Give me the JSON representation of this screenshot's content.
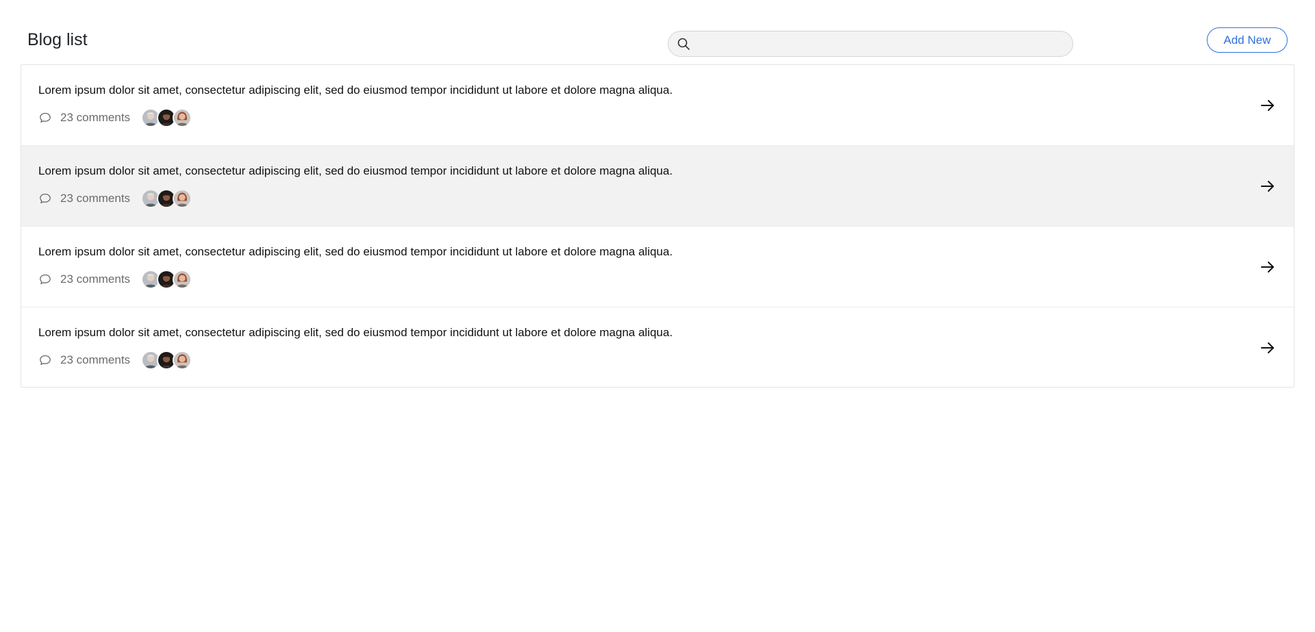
{
  "header": {
    "title": "Blog list",
    "search_placeholder": "",
    "search_value": "",
    "add_new_label": "Add New"
  },
  "colors": {
    "accent": "#2f6fdc",
    "row_highlight": "#f2f2f2",
    "border": "#e3e3e3"
  },
  "posts": [
    {
      "title": "Lorem ipsum dolor sit amet, consectetur adipiscing elit, sed do eiusmod tempor incididunt ut labore et dolore magna aliqua.",
      "comments": "23 comments",
      "highlighted": false
    },
    {
      "title": "Lorem ipsum dolor sit amet, consectetur adipiscing elit, sed do eiusmod tempor incididunt ut labore et dolore magna aliqua.",
      "comments": "23 comments",
      "highlighted": true
    },
    {
      "title": "Lorem ipsum dolor sit amet, consectetur adipiscing elit, sed do eiusmod tempor incididunt ut labore et dolore magna aliqua.",
      "comments": "23 comments",
      "highlighted": false
    },
    {
      "title": "Lorem ipsum dolor sit amet, consectetur adipiscing elit, sed do eiusmod tempor incididunt ut labore et dolore magna aliqua.",
      "comments": "23 comments",
      "highlighted": false
    }
  ],
  "icons": {
    "search": "search-icon",
    "comment": "comment-icon",
    "arrow": "arrow-right-icon",
    "avatar": "avatar"
  }
}
